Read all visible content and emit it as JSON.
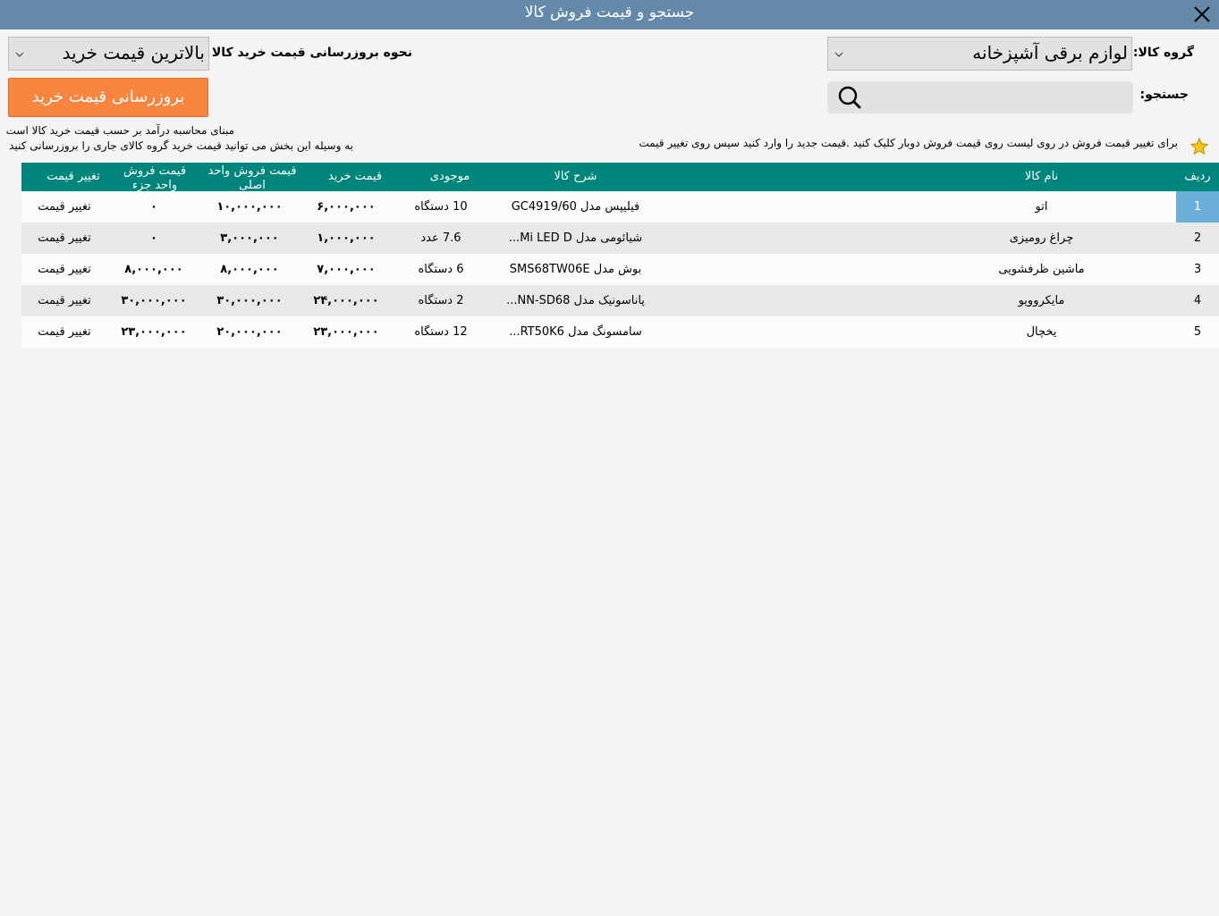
{
  "window": {
    "title": "جستجو و قیمت فروش کالا",
    "close_icon": "close-icon"
  },
  "filters": {
    "group_label": "گروه کالا:",
    "group_value": "لوازم برقی آشپزخانه",
    "search_label": "جستجو:",
    "search_value": "",
    "update_method_label": "نحوه بروزرسانی قیمت خرید کالا :",
    "update_method_value": "بالاترین قیمت خرید",
    "update_button": "بروزرسانی قیمت خرید"
  },
  "notes": {
    "tip": "برای تغییر قیمت فروش در روی لیست روی قیمت فروش دوبار کلیک کنید .قیمت جدید را وارد کنید سپس روی تغییر قیمت",
    "info_line1": "مبنای محاسبه درآمد بر حسب قیمت خرید کالا است",
    "info_line2": "به وسیله این بخش می توانید قیمت خرید گروه کالای جاری را بروزرسانی کنید"
  },
  "table": {
    "columns": {
      "row": "ردیف",
      "name": "نام کالا",
      "desc": "شرح کالا",
      "stock": "موجودی",
      "buy": "قیمت خرید",
      "sell_wholesale": "قیمت فروش واحد اصلی",
      "sell_retail": "قیمت فروش واحد جزء",
      "change": "تغییر قیمت"
    },
    "rows": [
      {
        "row": "1",
        "name": "اتو",
        "desc": "فیلیپس مدل GC4919/60",
        "stock": "10 دستگاه",
        "buy": "۶,۰۰۰,۰۰۰",
        "sell_wholesale": "۱۰,۰۰۰,۰۰۰",
        "sell_retail": "۰",
        "change": "تغییر قیمت"
      },
      {
        "row": "2",
        "name": "چراغ رومیزی",
        "desc": "شیائومی مدل Mi LED D...",
        "stock": "7.6 عدد",
        "buy": "۱,۰۰۰,۰۰۰",
        "sell_wholesale": "۳,۰۰۰,۰۰۰",
        "sell_retail": "۰",
        "change": "تغییر قیمت"
      },
      {
        "row": "3",
        "name": "ماشین ظرفشویی",
        "desc": "بوش مدل SMS68TW06E",
        "stock": "6 دستگاه",
        "buy": "۷,۰۰۰,۰۰۰",
        "sell_wholesale": "۸,۰۰۰,۰۰۰",
        "sell_retail": "۸,۰۰۰,۰۰۰",
        "change": "تغییر قیمت"
      },
      {
        "row": "4",
        "name": "مایکروویو",
        "desc": "پاناسونیک مدل NN-SD68...",
        "stock": "2 دستگاه",
        "buy": "۲۴,۰۰۰,۰۰۰",
        "sell_wholesale": "۳۰,۰۰۰,۰۰۰",
        "sell_retail": "۳۰,۰۰۰,۰۰۰",
        "change": "تغییر قیمت"
      },
      {
        "row": "5",
        "name": "یخچال",
        "desc": "سامسونگ مدل RT50K6...",
        "stock": "12 دستگاه",
        "buy": "۲۳,۰۰۰,۰۰۰",
        "sell_wholesale": "۲۰,۰۰۰,۰۰۰",
        "sell_retail": "۲۳,۰۰۰,۰۰۰",
        "change": "تغییر قیمت"
      }
    ]
  },
  "colors": {
    "titlebar": "#6589a9",
    "header": "#00857c",
    "accent_button": "#f7843f",
    "selected_cell": "#69afd8"
  }
}
